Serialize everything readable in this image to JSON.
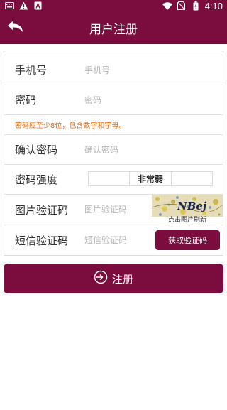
{
  "status_bar": {
    "time": "4:10",
    "left_icons": [
      "keyboard-icon",
      "warning-icon",
      "a-icon"
    ],
    "right_icons": [
      "wifi-icon",
      "no-sim-icon",
      "battery-charging-icon"
    ]
  },
  "header": {
    "title": "用户注册",
    "back_icon": "back-arrow-icon"
  },
  "form": {
    "phone": {
      "label": "手机号",
      "placeholder": "手机号",
      "value": ""
    },
    "password": {
      "label": "密码",
      "placeholder": "密码",
      "value": ""
    },
    "password_hint": "密码应至少8位，包含数字和字母。",
    "confirm": {
      "label": "确认密码",
      "placeholder": "确认密码",
      "value": ""
    },
    "strength": {
      "label": "密码强度",
      "levels": [
        "",
        "非常弱",
        ""
      ]
    },
    "captcha": {
      "label": "图片验证码",
      "placeholder": "图片验证码",
      "value": "",
      "image_text": "NBej",
      "caption": "点击图片刷新"
    },
    "sms": {
      "label": "短信验证码",
      "placeholder": "短信验证码",
      "value": "",
      "button_label": "获取验证码"
    }
  },
  "register_button": {
    "label": "注册",
    "icon": "login-arrow-icon"
  },
  "colors": {
    "brand": "#7a0d3e",
    "hint": "#e8690c"
  }
}
